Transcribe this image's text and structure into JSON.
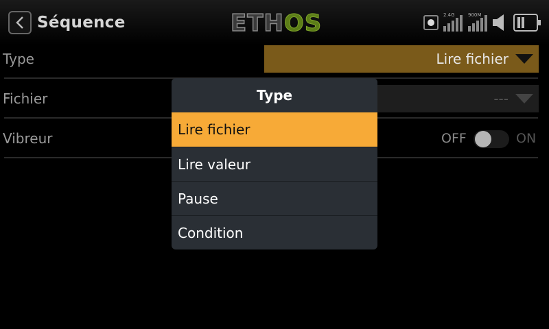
{
  "header": {
    "title": "Séquence",
    "logo_left": "ETH",
    "logo_right": "OS",
    "status": {
      "band1_label": "2.4G",
      "band2_label": "900M"
    }
  },
  "form": {
    "type": {
      "label": "Type",
      "value": "Lire fichier"
    },
    "file": {
      "label": "Fichier",
      "value": "---"
    },
    "vibrator": {
      "label": "Vibreur",
      "off_label": "OFF",
      "on_label": "ON",
      "state": "off"
    }
  },
  "popup": {
    "title": "Type",
    "options": [
      {
        "label": "Lire fichier",
        "selected": true
      },
      {
        "label": "Lire valeur",
        "selected": false
      },
      {
        "label": "Pause",
        "selected": false
      },
      {
        "label": "Condition",
        "selected": false
      }
    ]
  },
  "colors": {
    "accent": "#f7aa37",
    "active_field": "#7a5a1a",
    "popup_bg": "#2a2f35",
    "logo_green": "#5c7d18"
  }
}
